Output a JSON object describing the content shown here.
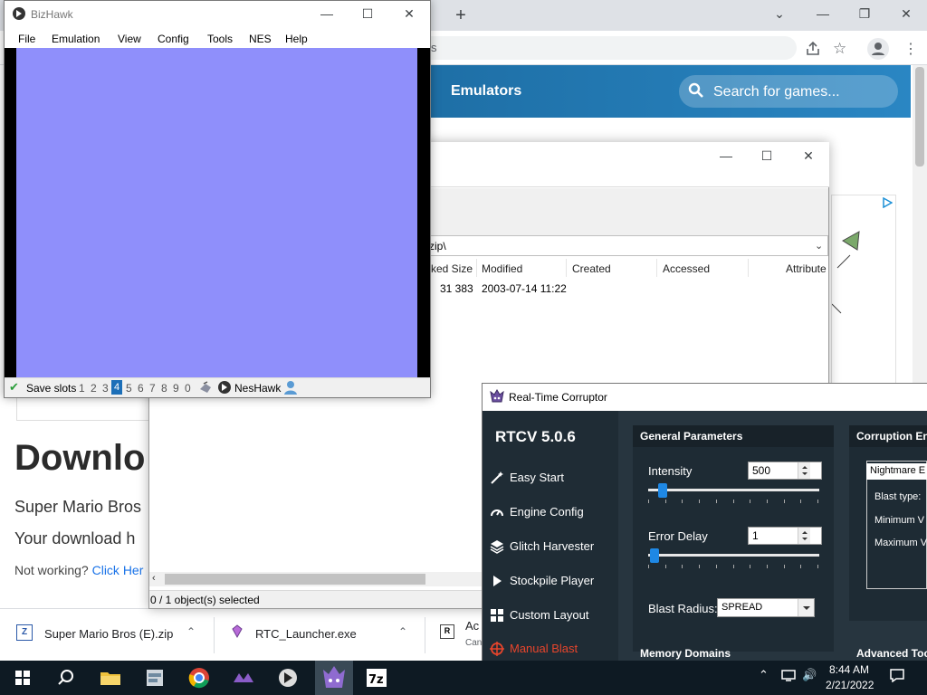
{
  "browser": {
    "omnibox_fragment": "s",
    "site_nav": "Emulators",
    "search_placeholder": "Search for games...",
    "heading": "Downlo",
    "subtitle": "Super Mario Bros",
    "download_text": "Your download h",
    "not_working": "Not working?",
    "click_here": "Click Her"
  },
  "downloads": [
    {
      "name": "Super Mario Bros (E).zip"
    },
    {
      "name": "RTC_Launcher.exe"
    },
    {
      "name": "Ac",
      "sub": "Can"
    }
  ],
  "zip": {
    "path": "zip\\",
    "columns": [
      "cked Size",
      "Modified",
      "Created",
      "Accessed",
      "Attribute"
    ],
    "row": {
      "packed": "31 383",
      "modified": "2003-07-14 11:22"
    },
    "status": "0 / 1 object(s) selected"
  },
  "bizhawk": {
    "title": "BizHawk",
    "menu": [
      "File",
      "Emulation",
      "View",
      "Config",
      "Tools",
      "NES",
      "Help"
    ],
    "save_slots_label": "Save slots",
    "slots": [
      "1",
      "2",
      "3",
      "4",
      "5",
      "6",
      "7",
      "8",
      "9",
      "0"
    ],
    "selected_slot": "4",
    "core": "NesHawk",
    "screen_color": "#8f8ffb"
  },
  "rtcv": {
    "window_title": "Real-Time Corruptor",
    "version": "RTCV 5.0.6",
    "sidebar": [
      {
        "label": "Easy Start",
        "icon": "wand-icon"
      },
      {
        "label": "Engine Config",
        "icon": "gauge-icon"
      },
      {
        "label": "Glitch Harvester",
        "icon": "layers-icon"
      },
      {
        "label": "Stockpile Player",
        "icon": "play-icon"
      },
      {
        "label": "Custom Layout",
        "icon": "grid-icon"
      },
      {
        "label": "Manual Blast",
        "icon": "target-icon",
        "active": true
      }
    ],
    "general_parameters": {
      "title": "General Parameters",
      "intensity_label": "Intensity",
      "intensity_value": "500",
      "intensity_level": 0.05,
      "error_delay_label": "Error Delay",
      "error_delay_value": "1",
      "error_delay_level": 0.0,
      "blast_radius_label": "Blast Radius:",
      "blast_radius_value": "SPREAD"
    },
    "corruption_engine": {
      "title": "Corruption Eng",
      "engine": "Nightmare E",
      "blast_type": "Blast type:",
      "min": "Minimum V",
      "max": "Maximum V"
    },
    "memory_domains": "Memory Domains",
    "advanced_tools": "Advanced Too"
  },
  "clock": {
    "time": "8:44 AM",
    "date": "2/21/2022"
  },
  "colors": {
    "accent": "#1e88e5",
    "active_nav": "#e8452c"
  }
}
